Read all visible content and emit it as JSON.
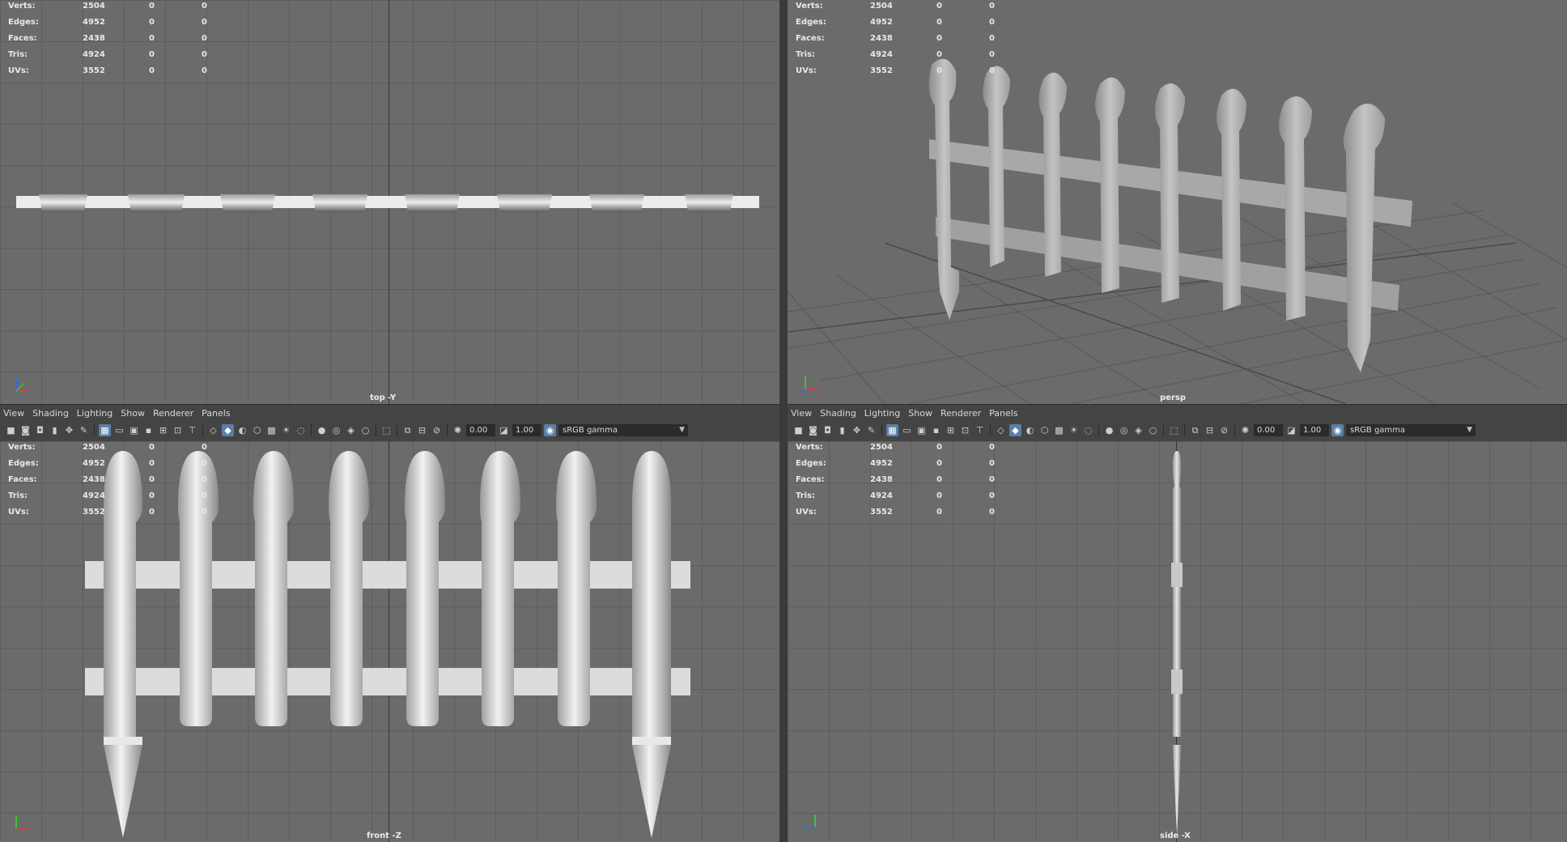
{
  "stats": {
    "rows": [
      {
        "label": "Verts:",
        "v1": "2504",
        "v2": "0",
        "v3": "0"
      },
      {
        "label": "Edges:",
        "v1": "4952",
        "v2": "0",
        "v3": "0"
      },
      {
        "label": "Faces:",
        "v1": "2438",
        "v2": "0",
        "v3": "0"
      },
      {
        "label": "Tris:",
        "v1": "4924",
        "v2": "0",
        "v3": "0"
      },
      {
        "label": "UVs:",
        "v1": "3552",
        "v2": "0",
        "v3": "0"
      }
    ]
  },
  "viewports": {
    "top": {
      "label": "top -Y"
    },
    "persp": {
      "label": "persp"
    },
    "front": {
      "label": "front -Z"
    },
    "side": {
      "label": "side -X"
    }
  },
  "panel_menu": {
    "view": "View",
    "shading": "Shading",
    "lighting": "Lighting",
    "show": "Show",
    "renderer": "Renderer",
    "panels": "Panels"
  },
  "panel_toolbar": {
    "exposure": "0.00",
    "gamma": "1.00",
    "color_space": "sRGB gamma"
  },
  "colors": {
    "viewport_bg": "#6b6b6b",
    "grid": "#5d5d5d",
    "active_tool": "#5a7fa8"
  }
}
